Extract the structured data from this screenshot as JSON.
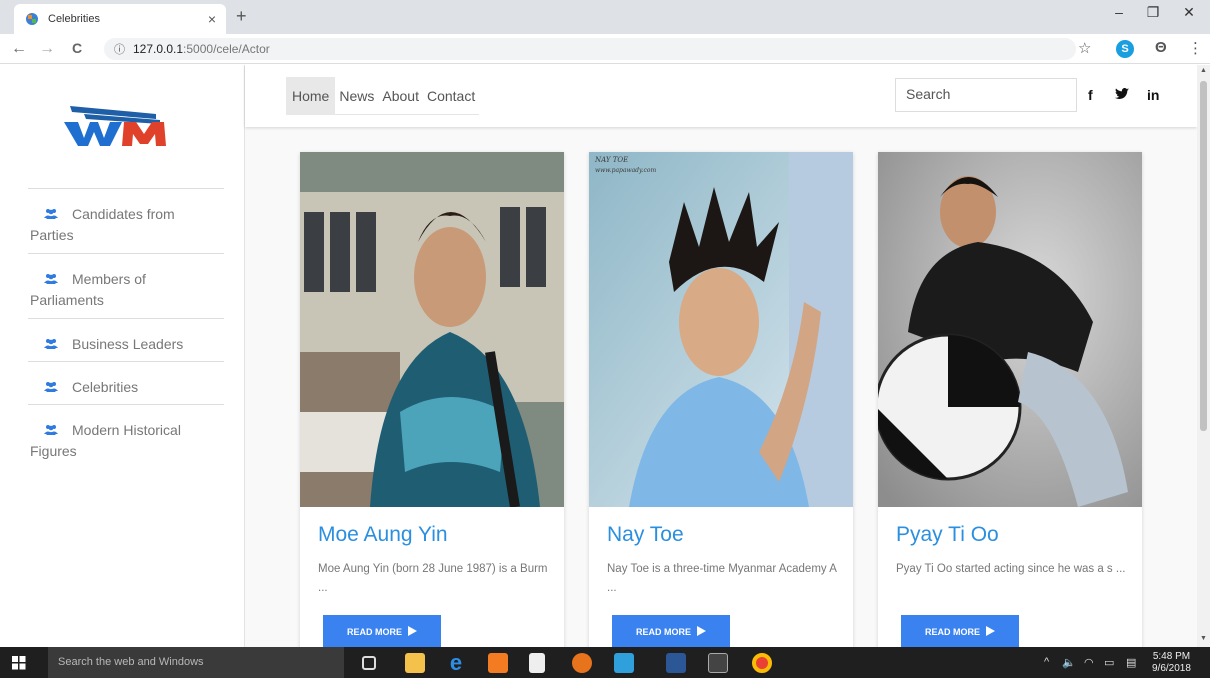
{
  "browser": {
    "tab_title": "Celebrities",
    "close_glyph": "×",
    "new_tab_glyph": "+",
    "url_host": "127.0.0.1",
    "url_path": ":5000/cele/Actor",
    "info_glyph": "ⓘ",
    "window_controls": {
      "minimize": "–",
      "restore": "❐",
      "close": "✕"
    },
    "nav": {
      "back": "←",
      "forward": "→",
      "reload": "C"
    },
    "star": "☆",
    "skype": "S",
    "account": "Θ",
    "menu": "⋮"
  },
  "sidebar": {
    "logo_name": "wm-logo",
    "items": [
      {
        "label_line1": "Candidates from",
        "label_line2": "Parties"
      },
      {
        "label_line1": "Members of",
        "label_line2": "Parliaments"
      },
      {
        "label_line1": "Business Leaders",
        "label_line2": ""
      },
      {
        "label_line1": "Celebrities",
        "label_line2": ""
      },
      {
        "label_line1": "Modern Historical",
        "label_line2": "Figures"
      }
    ]
  },
  "topnav": {
    "links": [
      "Home",
      "News",
      "About",
      "Contact"
    ],
    "search_placeholder": "Search",
    "social": {
      "facebook": "f",
      "twitter": "🐦",
      "linkedin": "in"
    }
  },
  "cards": [
    {
      "name": "Moe Aung Yin",
      "desc": "Moe Aung Yin (born 28 June 1987) is a Burm ...",
      "button": "READ MORE"
    },
    {
      "name": "Nay Toe",
      "desc": "Nay Toe is a three-time Myanmar Academy A ...",
      "button": "READ MORE",
      "watermark": "NAY TOE\nwww.papawady.com"
    },
    {
      "name": "Pyay Ti Oo",
      "desc": "Pyay Ti Oo started acting since he was a s ...",
      "button": "READ MORE"
    }
  ],
  "taskbar": {
    "search_placeholder": "Search the web and Windows",
    "time": "5:48 PM",
    "date": "9/6/2018"
  },
  "colors": {
    "accent": "#2b8fe0",
    "button": "#3a82f0",
    "sidebar_icon": "#2f7be0"
  }
}
